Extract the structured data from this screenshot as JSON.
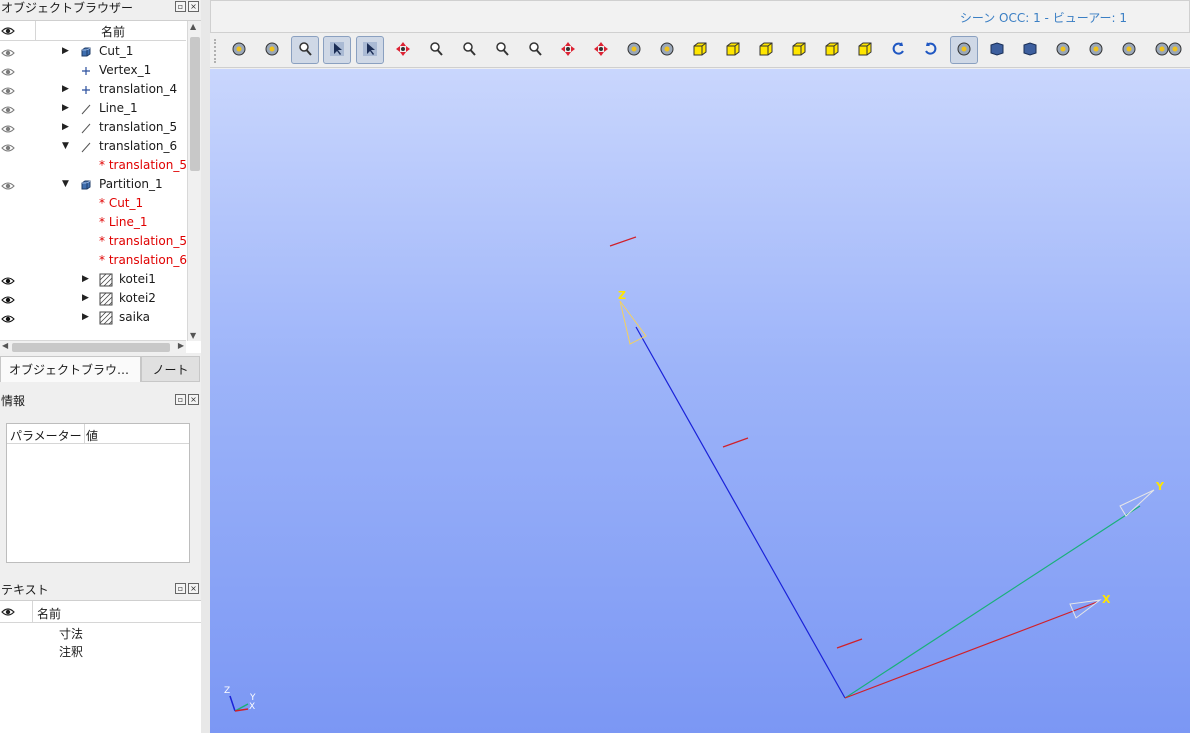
{
  "object_browser": {
    "title": "オブジェクトブラウザー",
    "header_name": "名前",
    "items": [
      {
        "label": "Cut_1",
        "visible": true,
        "expander": "collapsed",
        "icon": "solid-icon",
        "is_reference": false
      },
      {
        "label": "Vertex_1",
        "visible": true,
        "expander": "none",
        "icon": "vertex-icon",
        "is_reference": false
      },
      {
        "label": "translation_4",
        "visible": true,
        "expander": "collapsed",
        "icon": "vertex-icon",
        "is_reference": false
      },
      {
        "label": "Line_1",
        "visible": true,
        "expander": "collapsed",
        "icon": "line-icon",
        "is_reference": false
      },
      {
        "label": "translation_5",
        "visible": true,
        "expander": "collapsed",
        "icon": "line-icon",
        "is_reference": false
      },
      {
        "label": "translation_6",
        "visible": true,
        "expander": "expanded",
        "icon": "line-icon",
        "is_reference": false
      },
      {
        "label": "* translation_5",
        "visible": false,
        "expander": "none",
        "icon": "",
        "is_reference": true
      },
      {
        "label": "Partition_1",
        "visible": true,
        "expander": "expanded",
        "icon": "solid-icon",
        "is_reference": false
      },
      {
        "label": "* Cut_1",
        "visible": false,
        "expander": "none",
        "icon": "",
        "is_reference": true
      },
      {
        "label": "* Line_1",
        "visible": false,
        "expander": "none",
        "icon": "",
        "is_reference": true
      },
      {
        "label": "* translation_5",
        "visible": false,
        "expander": "none",
        "icon": "",
        "is_reference": true
      },
      {
        "label": "* translation_6",
        "visible": false,
        "expander": "none",
        "icon": "",
        "is_reference": true
      },
      {
        "label": "kotei1",
        "visible": true,
        "expander": "collapsed",
        "icon": "group-icon",
        "is_reference": false
      },
      {
        "label": "kotei2",
        "visible": true,
        "expander": "collapsed",
        "icon": "group-icon",
        "is_reference": false
      },
      {
        "label": "saika",
        "visible": true,
        "expander": "collapsed",
        "icon": "group-icon",
        "is_reference": false
      }
    ]
  },
  "tabs": {
    "object_browser_tab": "オブジェクトブラウ…",
    "notes_tab": "ノート"
  },
  "info": {
    "title": "情報",
    "col_param": "パラメーター",
    "col_value": "値"
  },
  "text_panel": {
    "title": "テキスト",
    "header_name": "名前",
    "items": [
      "寸法",
      "注釈"
    ]
  },
  "viewer": {
    "title": "シーン OCC: 1 - ビューアー: 1",
    "axis_labels": {
      "x": "X",
      "y": "Y",
      "z": "Z"
    },
    "colors": {
      "x_axis": "#d0202a",
      "y_axis": "#19b07a",
      "z_axis": "#1a22d8",
      "label": "#ffe600"
    }
  },
  "toolbar": {
    "icons": [
      "dump-view-icon",
      "mouse-interaction-icon",
      "fit-area-icon",
      "select-icon",
      "select-rect-icon",
      "global-pan-icon",
      "zoom-icon",
      "fit-all-icon",
      "fit-selection-icon",
      "zoom-window-icon",
      "pan-icon",
      "global-pan-all-icon",
      "rotate-icon",
      "rotation-center-icon",
      "view-front-icon",
      "view-back-icon",
      "view-top-icon",
      "view-bottom-icon",
      "view-left-icon",
      "view-right-icon",
      "rotate-counterclockwise-icon",
      "rotate-clockwise-icon",
      "reset-view-icon",
      "shading-icon",
      "display-mode-icon",
      "clipping-icon",
      "axes-icon",
      "graduated-axes-icon",
      "ambient-light-icon",
      "sync-view-icon"
    ],
    "pressed": [
      "fit-area-icon",
      "select-icon",
      "select-rect-icon",
      "reset-view-icon"
    ]
  }
}
